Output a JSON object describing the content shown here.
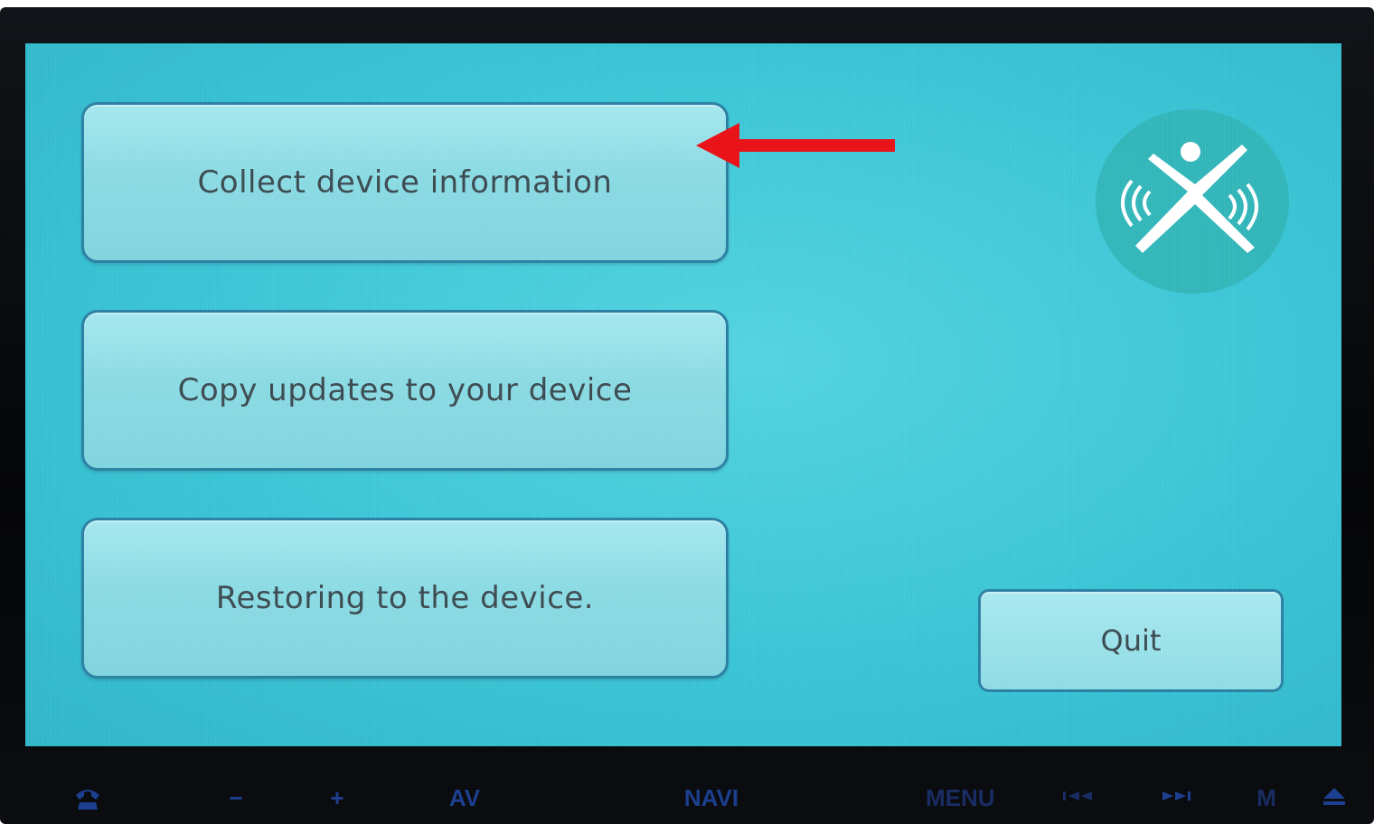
{
  "screen": {
    "buttons": [
      {
        "label": "Collect device information"
      },
      {
        "label": "Copy updates to your device"
      },
      {
        "label": "Restoring to the device."
      }
    ],
    "quit_label": "Quit",
    "logo_icon": "x-person-wireless-logo-icon",
    "annotation_icon": "red-arrow-left-icon"
  },
  "hardware_keys": {
    "phone": "phone-icon",
    "minus": "−",
    "plus": "+",
    "av": "AV",
    "navi": "NAVI",
    "menu": "MENU",
    "prev": "prev-track-icon",
    "next": "next-track-icon",
    "m": "M",
    "eject": "eject-icon"
  },
  "colors": {
    "screen": "#39c4d5",
    "button_border": "#2a7fa3",
    "arrow": "#e8141a",
    "hw_key": "#1d3f8f"
  }
}
